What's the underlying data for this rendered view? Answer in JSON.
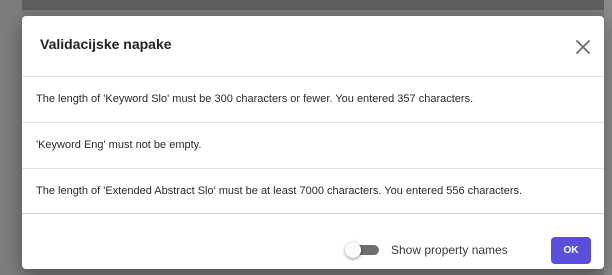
{
  "dialog": {
    "title": "Validacijske napake",
    "close_icon": "close-icon",
    "errors": [
      "The length of 'Keyword Slo' must be 300 characters or fewer. You entered 357 characters.",
      "'Keyword Eng' must not be empty.",
      "The length of 'Extended Abstract Slo' must be at least 7000 characters. You entered 556 characters."
    ],
    "footer": {
      "toggle_label": "Show property names",
      "toggle_on": false,
      "ok_label": "OK"
    }
  },
  "colors": {
    "accent": "#5a4fdc",
    "overlay": "#7a7a7a"
  }
}
